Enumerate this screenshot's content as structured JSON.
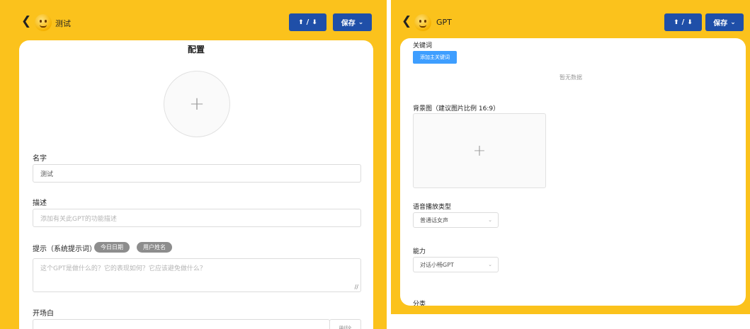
{
  "left": {
    "header": {
      "title": "测试",
      "import_export_label": "/",
      "save_label": "保存"
    },
    "card": {
      "heading": "配置",
      "name": {
        "label": "名字",
        "value": "测试"
      },
      "description": {
        "label": "描述",
        "placeholder": "添加有关此GPT的功能描述"
      },
      "prompt": {
        "label": "提示（系统提示词）",
        "tags": [
          "今日日期",
          "用户姓名"
        ],
        "placeholder": "这个GPT是做什么的？它的表现如何？它应该避免做什么？"
      },
      "opening": {
        "label": "开场白",
        "side_button": "删除"
      }
    }
  },
  "right": {
    "header": {
      "title": "GPT",
      "import_export_label": "/",
      "save_label": "保存"
    },
    "card": {
      "keywords": {
        "label": "关键词",
        "add_button": "添加主关键词",
        "empty": "暂无数据"
      },
      "background": {
        "label": "背景图（建议图片比例 16:9）"
      },
      "voice": {
        "label": "语音播放类型",
        "selected": "普通话女声"
      },
      "ability": {
        "label": "能力",
        "selected": "对话小畅GPT"
      },
      "category": {
        "label": "分类"
      }
    }
  },
  "icons": [
    "back-arrow-icon",
    "emoji-avatar-icon",
    "upload-icon",
    "download-icon",
    "chevron-down-icon",
    "plus-icon",
    "resize-handle-icon"
  ],
  "colors": {
    "panel_bg": "#FBC21C",
    "button_bg": "#1F4FA8",
    "add_button_bg": "#3E9EFF",
    "tag_bg": "#8D8D8D"
  }
}
